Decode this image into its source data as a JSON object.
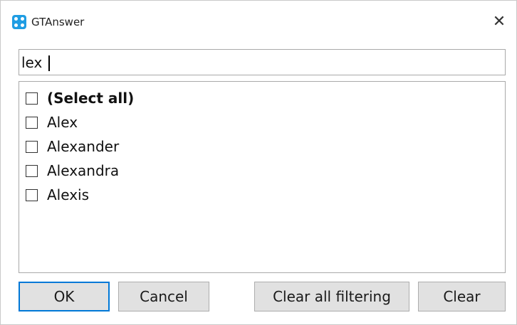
{
  "window": {
    "title": "GTAnswer",
    "close_glyph": "✕",
    "icon": "app-icon"
  },
  "search": {
    "value": "lex",
    "placeholder": ""
  },
  "list": {
    "items": [
      {
        "label": "(Select all)",
        "checked": false,
        "bold": true
      },
      {
        "label": "Alex",
        "checked": false
      },
      {
        "label": "Alexander",
        "checked": false
      },
      {
        "label": "Alexandra",
        "checked": false
      },
      {
        "label": "Alexis",
        "checked": false
      }
    ]
  },
  "buttons": {
    "ok": "OK",
    "cancel": "Cancel",
    "clear_all_filtering": "Clear all filtering",
    "clear": "Clear"
  },
  "colors": {
    "accent": "#0078d7",
    "app_icon": "#1f9de3",
    "button_face": "#e1e1e1"
  }
}
